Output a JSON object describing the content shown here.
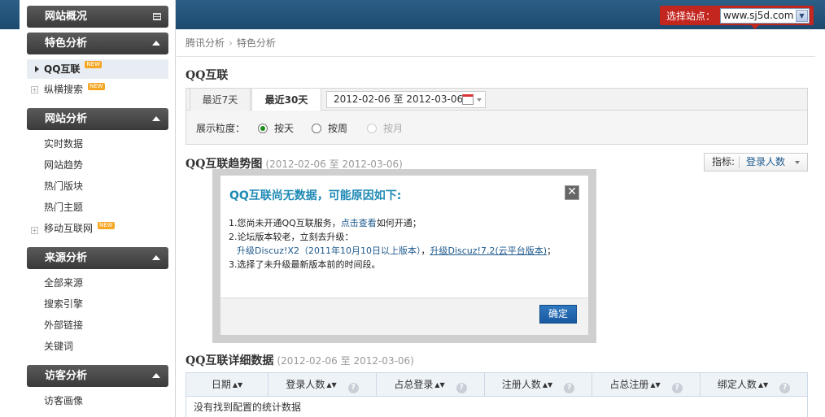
{
  "topbar": {
    "site_label": "选择站点：",
    "site_value": "www.sj5d.com"
  },
  "sidebar": {
    "sections": [
      {
        "label": "网站概况"
      },
      {
        "label": "特色分析",
        "items": [
          {
            "label": "QQ互联",
            "badge": "NEW",
            "active": true
          },
          {
            "label": "纵横搜索",
            "badge": "NEW"
          }
        ]
      },
      {
        "label": "网站分析",
        "items": [
          {
            "label": "实时数据"
          },
          {
            "label": "网站趋势"
          },
          {
            "label": "热门版块"
          },
          {
            "label": "热门主题"
          },
          {
            "label": "移动互联网",
            "badge": "NEW"
          }
        ]
      },
      {
        "label": "来源分析",
        "items": [
          {
            "label": "全部来源"
          },
          {
            "label": "搜索引擎"
          },
          {
            "label": "外部链接"
          },
          {
            "label": "关键词"
          }
        ]
      },
      {
        "label": "访客分析",
        "items": [
          {
            "label": "访客画像"
          }
        ]
      }
    ]
  },
  "main": {
    "breadcrumb": [
      "腾讯分析",
      "特色分析"
    ],
    "title": "QQ互联",
    "tabs": [
      {
        "label": "最近7天"
      },
      {
        "label": "最近30天",
        "active": true
      }
    ],
    "date_range": "2012-02-06 至  2012-03-06",
    "granularity": {
      "label": "展示粒度：",
      "options": [
        {
          "label": "按天",
          "selected": true
        },
        {
          "label": "按周"
        },
        {
          "label": "按月",
          "disabled": true
        }
      ]
    },
    "trend": {
      "title": "QQ互联趋势图",
      "range": "(2012-02-06 至 2012-03-06)"
    },
    "indicator": {
      "label": "指标:",
      "value": "登录人数"
    },
    "detail": {
      "title": "QQ互联详细数据",
      "range": "(2012-02-06 至 2012-03-06)"
    },
    "table": {
      "columns": [
        "日期",
        "登录人数",
        "占总登录",
        "注册人数",
        "占总注册",
        "绑定人数"
      ],
      "empty_text": "没有找到配置的统计数据"
    }
  },
  "modal": {
    "title": "QQ互联尚无数据，可能原因如下:",
    "line1_a": "1.您尚未开通QQ互联服务，",
    "line1_link": "点击查看",
    "line1_b": "如何开通；",
    "line2": "2.论坛版本较老，立刻去升级：",
    "line3_link1": "升级Discuz!X2（2011年10月10日以上版本）",
    "line3_sep": "，",
    "line3_link2": "升级Discuz!7.2(云平台版本)",
    "line3_end": "；",
    "line4": "3.选择了未升级最新版本前的时间段。",
    "ok_label": "确定"
  },
  "colors": {
    "accent": "#1e8ab5",
    "topbar": "#1d4a6f",
    "site_select": "#c3251f"
  }
}
